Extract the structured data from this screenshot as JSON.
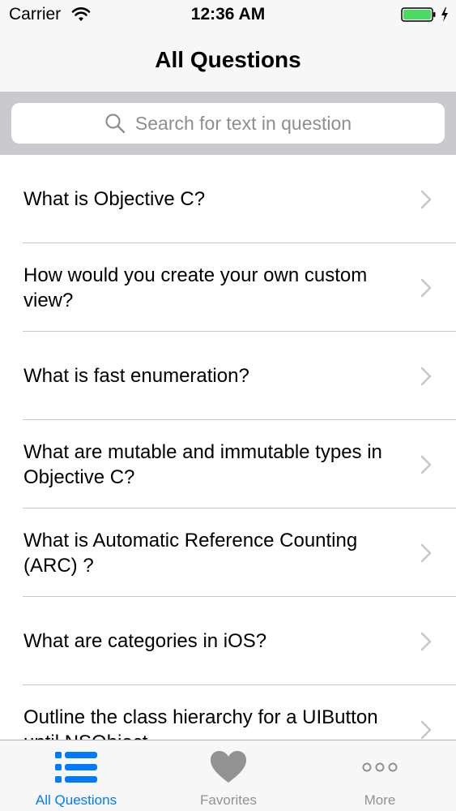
{
  "status_bar": {
    "carrier": "Carrier",
    "time": "12:36 AM",
    "battery_color": "#4cd964"
  },
  "nav": {
    "title": "All Questions"
  },
  "search": {
    "placeholder": "Search for text in question"
  },
  "questions": [
    {
      "label": "What is Objective C?"
    },
    {
      "label": "How would you create your own custom view?"
    },
    {
      "label": "What is fast enumeration?"
    },
    {
      "label": "What are mutable and immutable types in Objective C?"
    },
    {
      "label": "What is Automatic Reference Counting (ARC) ?"
    },
    {
      "label": "What are categories in iOS?"
    },
    {
      "label": "Outline the class hierarchy for a UIButton until NSObject"
    }
  ],
  "tabs": [
    {
      "label": "All Questions",
      "icon": "list-icon",
      "selected": true
    },
    {
      "label": "Favorites",
      "icon": "heart-icon",
      "selected": false
    },
    {
      "label": "More",
      "icon": "more-icon",
      "selected": false
    }
  ],
  "colors": {
    "accent": "#007aff",
    "inactive_tab": "#929292",
    "search_bar_bg": "#c9c9ce"
  }
}
